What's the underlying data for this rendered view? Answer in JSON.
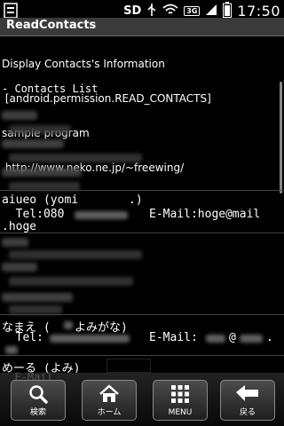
{
  "status": {
    "carrier_text": "SD",
    "network_badge": "3G",
    "time": "17:50",
    "icons": [
      "menu-icon",
      "sd-card-icon",
      "usb-icon",
      "wifi-icon",
      "signal-icon",
      "battery-icon"
    ]
  },
  "app": {
    "title": "ReadContacts"
  },
  "intro": {
    "line1": "Display Contacts's Information",
    "line2": " [android.permission.READ_CONTACTS]",
    "line3": "sample program",
    "line4": " http://www.neko.ne.jp/~freewing/"
  },
  "list": {
    "title": "- Contacts List",
    "row1_name": "aiueo (yomi",
    "row1_name_end": ".)",
    "row1_tel_prefix": "  Tel:080",
    "row1_email": "E-Mail:hoge@mail",
    "row1_email_tail": ".hoge",
    "row2_name": "なまえ (",
    "row2_name_kana": "よみがな)",
    "row2_tel": "  Tel:",
    "row2_email": "E-Mail:",
    "row2_email_at": "@",
    "row2_email_dot": ".",
    "row3_name": "めーる (よみ)",
    "row3_sub": "  E-Mail"
  },
  "nav": {
    "search": "検索",
    "home": "ホーム",
    "menu": "MENU",
    "back": "戻る"
  },
  "colors": {
    "background": "#000000",
    "titlebar": "#3a3a3a",
    "text": "#ffffff"
  }
}
